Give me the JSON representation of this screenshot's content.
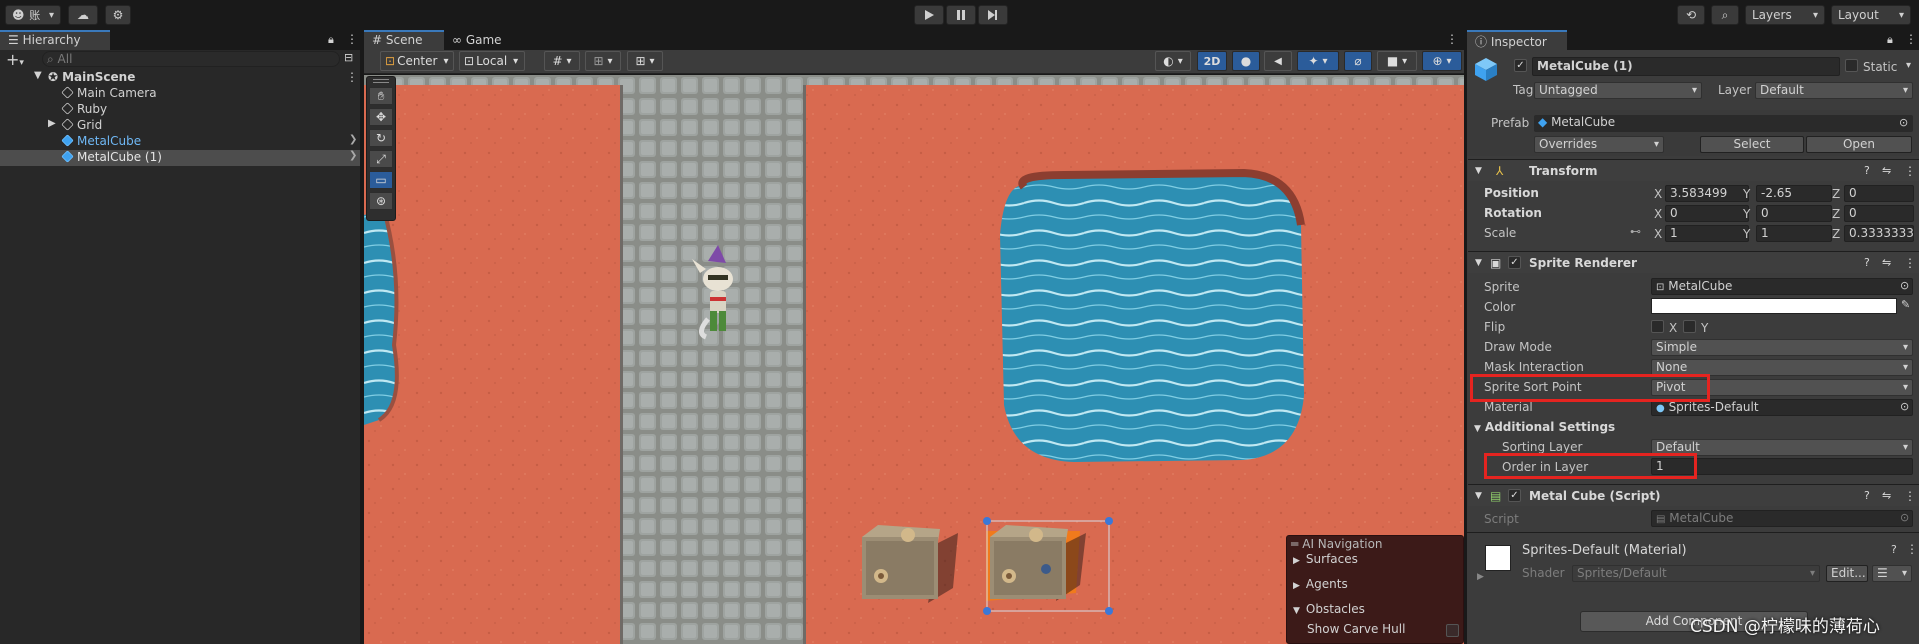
{
  "topbar": {
    "account_label": "账",
    "play_icon": "play-icon",
    "pause_icon": "pause-icon",
    "step_icon": "step-icon",
    "layers_label": "Layers",
    "layout_label": "Layout"
  },
  "hierarchy": {
    "tab": "Hierarchy",
    "add": "+",
    "search_placeholder": "All",
    "scene": "MainScene",
    "items": [
      {
        "label": "Main Camera"
      },
      {
        "label": "Ruby"
      },
      {
        "label": "Grid"
      },
      {
        "label": "MetalCube"
      },
      {
        "label": "MetalCube (1)"
      }
    ]
  },
  "scene_view": {
    "tabs": [
      "Scene",
      "Game"
    ],
    "pivot_mode": "Center",
    "pivot_space": "Local",
    "btn_2d": "2D",
    "overlay": {
      "title": "AI Navigation",
      "items": [
        "Surfaces",
        "Agents",
        "Obstacles"
      ],
      "option": "Show Carve Hull"
    }
  },
  "inspector": {
    "tab": "Inspector",
    "object_name": "MetalCube (1)",
    "static_label": "Static",
    "tag_label": "Tag",
    "tag_value": "Untagged",
    "layer_label": "Layer",
    "layer_value": "Default",
    "prefab_label": "Prefab",
    "prefab_value": "MetalCube",
    "overrides": "Overrides",
    "select": "Select",
    "open": "Open",
    "transform": {
      "title": "Transform",
      "position_label": "Position",
      "rotation_label": "Rotation",
      "scale_label": "Scale",
      "position": [
        "3.583499",
        "-2.65",
        "0"
      ],
      "rotation": [
        "0",
        "0",
        "0"
      ],
      "scale": [
        "1",
        "1",
        "0.3333333"
      ],
      "axes": [
        "X",
        "Y",
        "Z"
      ]
    },
    "sprite_renderer": {
      "title": "Sprite Renderer",
      "sprite_label": "Sprite",
      "sprite_value": "MetalCube",
      "color_label": "Color",
      "color_value": "#ffffff",
      "flip_label": "Flip",
      "flip_x": "X",
      "flip_y": "Y",
      "draw_mode_label": "Draw Mode",
      "draw_mode_value": "Simple",
      "mask_label": "Mask Interaction",
      "mask_value": "None",
      "sort_point_label": "Sprite Sort Point",
      "sort_point_value": "Pivot",
      "material_label": "Material",
      "material_value": "Sprites-Default",
      "additional_label": "Additional Settings",
      "sorting_layer_label": "Sorting Layer",
      "sorting_layer_value": "Default",
      "order_label": "Order in Layer",
      "order_value": "1"
    },
    "script": {
      "title": "Metal Cube (Script)",
      "script_label": "Script",
      "script_value": "MetalCube"
    },
    "material": {
      "title": "Sprites-Default (Material)",
      "shader_label": "Shader",
      "shader_value": "Sprites/Default",
      "edit": "Edit..."
    },
    "add_component": "Add Component"
  },
  "watermark": "CSDN @柠檬味的薄荷心",
  "colors": {
    "accent": "#3a79bb",
    "highlight_box": "#e52420",
    "ground": "#d96a50",
    "water": "#2d8fb3"
  }
}
